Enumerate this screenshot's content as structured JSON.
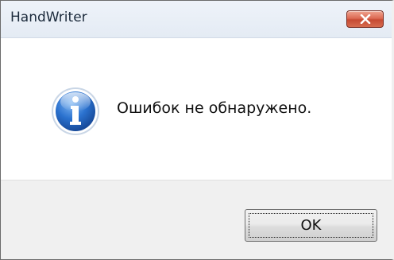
{
  "window": {
    "title": "HandWriter",
    "close_icon": "close-icon"
  },
  "message": {
    "icon": "info-icon",
    "text": "Ошибок не обнаружено."
  },
  "buttons": {
    "ok_label": "OK"
  },
  "colors": {
    "close_button": "#d65a43",
    "footer_background": "#f0f0f0",
    "icon_blue": "#1f5fbf"
  }
}
